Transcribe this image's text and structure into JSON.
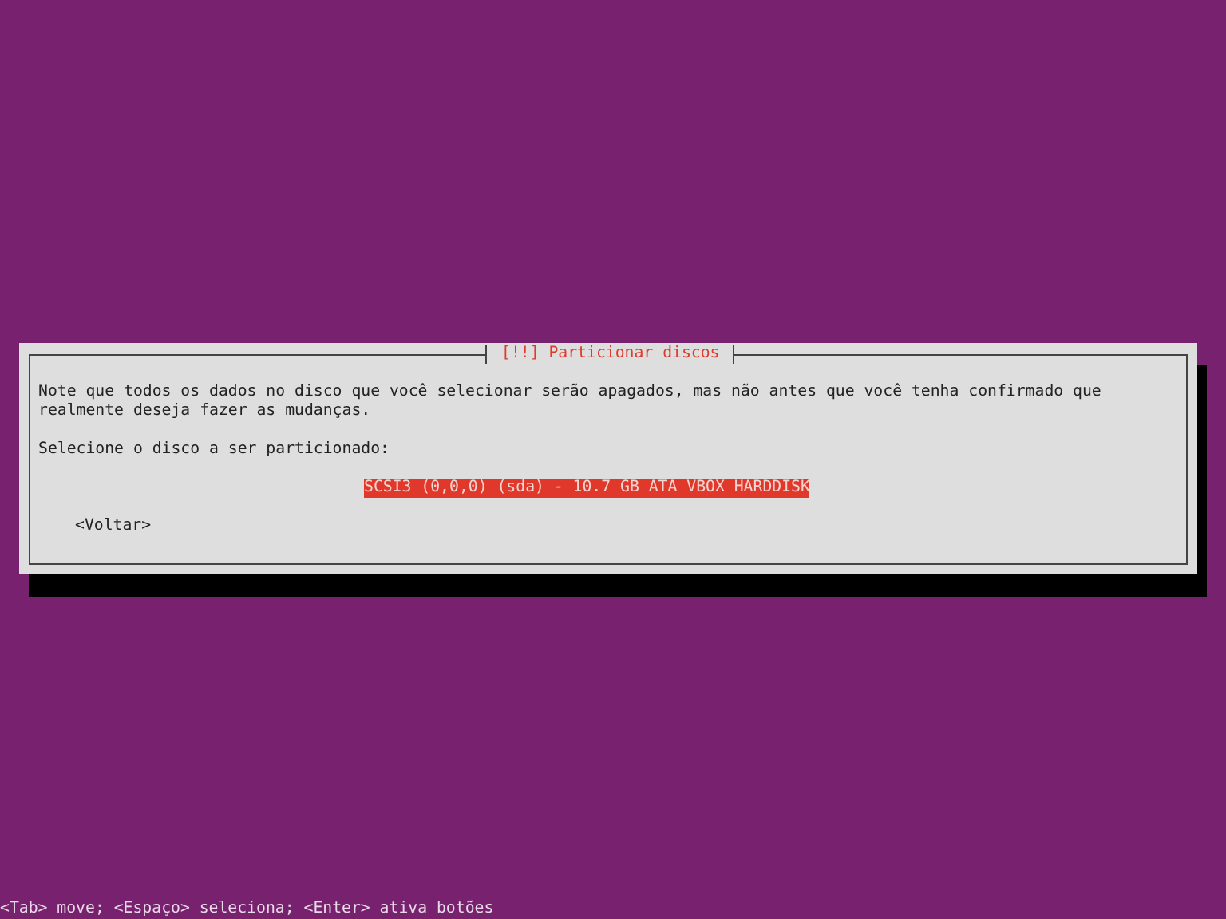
{
  "dialog": {
    "title": "[!!] Particionar discos",
    "message": "Note que todos os dados no disco que você selecionar serão apagados, mas não antes que você tenha confirmado que\nrealmente deseja fazer as mudanças.",
    "prompt": "Selecione o disco a ser particionado:",
    "disks": [
      {
        "label": "SCSI3 (0,0,0) (sda) - 10.7 GB ATA VBOX HARDDISK",
        "selected": true
      }
    ],
    "back_button": "<Voltar>"
  },
  "status_bar": "<Tab> move; <Espaço> seleciona; <Enter> ativa botões"
}
